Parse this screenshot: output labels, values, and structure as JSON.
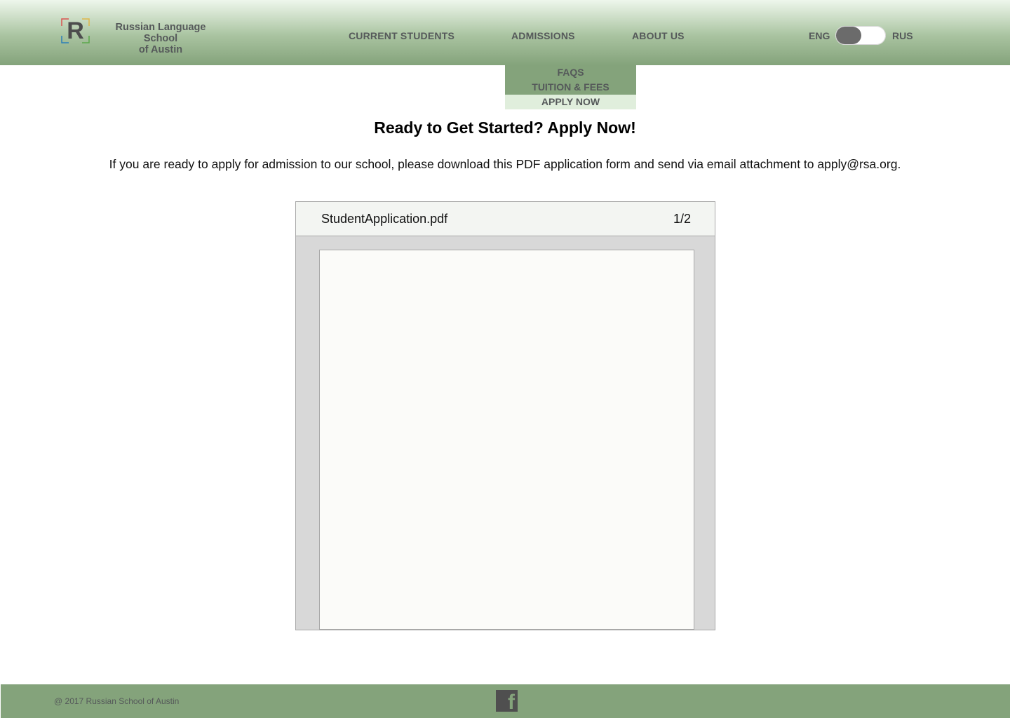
{
  "header": {
    "logo_letter": "R",
    "brand_line1": "Russian Language School",
    "brand_line2": "of Austin",
    "nav": {
      "current_students": "CURRENT STUDENTS",
      "admissions": "ADMISSIONS",
      "about_us": "ABOUT US"
    },
    "language": {
      "left": "ENG",
      "right": "RUS",
      "selected": "ENG"
    }
  },
  "admissions_menu": {
    "items": [
      "FAQS",
      "TUITION & FEES",
      "APPLY NOW"
    ],
    "active": "APPLY NOW"
  },
  "main": {
    "heading": "Ready to Get Started? Apply Now!",
    "intro": "If you are ready to apply for admission to our school, please download this PDF application form and send via email attachment to apply@rsa.org."
  },
  "pdf_viewer": {
    "filename": "StudentApplication.pdf",
    "page_indicator": "1/2"
  },
  "footer": {
    "copyright": "@ 2017 Russian School of Austin",
    "social_icon": "facebook-icon",
    "social_letter": "f"
  },
  "colors": {
    "header_green": "#84a37b",
    "header_light": "#eef7ec",
    "active_menu": "#e0eedc",
    "text_gray": "#55595a"
  }
}
